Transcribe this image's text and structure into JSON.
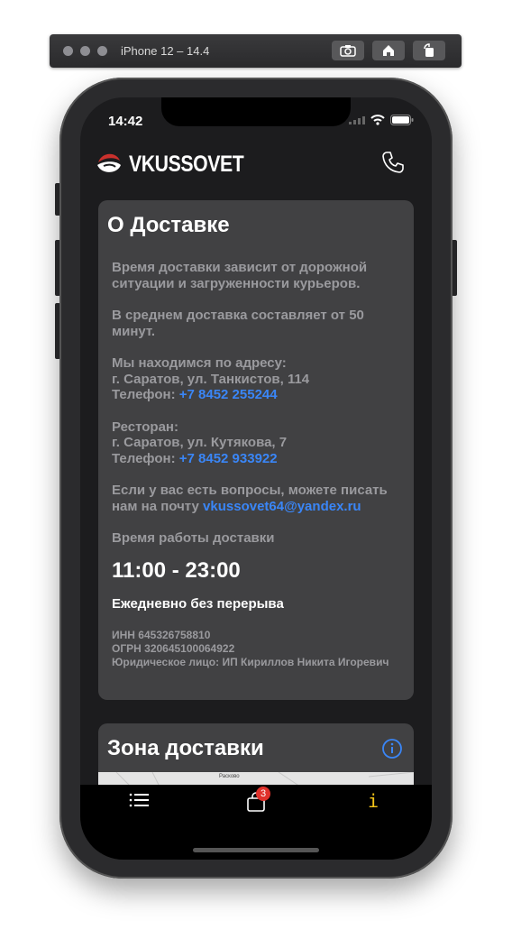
{
  "simulator": {
    "title": "iPhone 12 – 14.4"
  },
  "status_bar": {
    "time": "14:42"
  },
  "header": {
    "brand": "VKUSSOVET",
    "call_icon": "phone-icon"
  },
  "delivery": {
    "title": "О Доставке",
    "p1": "Время доставки зависит от дорожной ситуации и загруженности курьеров.",
    "p2": "В среднем доставка составляет от 50 минут.",
    "address_label": "Мы находимся по адресу:",
    "address": "г. Саратов, ул. Танкистов, 114",
    "phone_label": "Телефон:",
    "phone1": "+7 8452 255244",
    "restaurant_label": "Ресторан:",
    "restaurant_address": "г. Саратов, ул. Кутякова, 7",
    "phone2": "+7 8452 933922",
    "questions": "Если у вас есть вопросы, можете писать нам на почту",
    "email": "vkussovet64@yandex.ru",
    "hours_label": "Время работы доставки",
    "hours": "11:00 - 23:00",
    "daily": "Ежедневно без перерыва",
    "inn": "ИНН 645326758810",
    "ogrn": "ОГРН 320645100064922",
    "legal": "Юридическое лицо: ИП Кириллов Никита Игоревич"
  },
  "zone": {
    "title": "Зона доставки",
    "map_label": "Расково"
  },
  "tabbar": {
    "cart_count": "3",
    "info_label": "i"
  },
  "colors": {
    "link": "#3a86f7",
    "card": "#414143",
    "background": "#1c1c1e",
    "badge": "#e0312b",
    "info_tab": "#f5c518"
  }
}
